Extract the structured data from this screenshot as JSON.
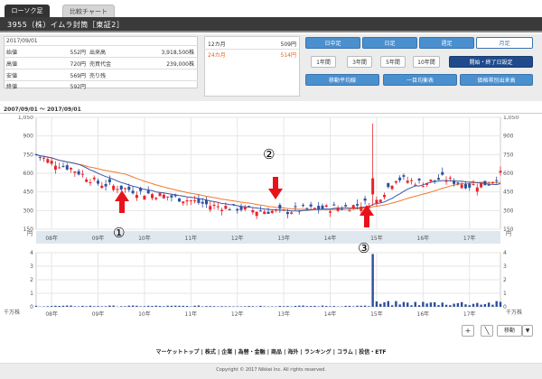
{
  "tabs": [
    {
      "label": "ローソク足",
      "active": true
    },
    {
      "label": "比較チャート",
      "active": false
    }
  ],
  "title": "3955（株）イムラ封筒［東証2］",
  "info": {
    "date": "2017/09/01",
    "rows": [
      {
        "l1": "始値",
        "v1": "552円",
        "l2": "出来高",
        "v2": "3,918,500株"
      },
      {
        "l1": "高値",
        "v1": "720円",
        "l2": "売買代金",
        "v2": "239,000株"
      },
      {
        "l1": "安値",
        "v1": "569円",
        "l2": "売り残",
        "v2": ""
      },
      {
        "l1": "終値",
        "v1": "592円",
        "l2": "",
        "v2": ""
      }
    ]
  },
  "price_panel": [
    {
      "label": "12カ月",
      "value": "509円",
      "color": "#333333"
    },
    {
      "label": "24カ月",
      "value": "514円",
      "color": "#e8621a"
    }
  ],
  "period_buttons": [
    "日中足",
    "日足",
    "週足",
    "月足"
  ],
  "selected_period": 3,
  "span_buttons": [
    "1年間",
    "3年間",
    "5年間",
    "10年間"
  ],
  "set_range_button": "開始・終了日設定",
  "indicator_buttons": [
    "移動平均線",
    "一目均衡表",
    "価格帯別出来高"
  ],
  "range_label": "2007/09/01 〜 2017/09/01",
  "price_axis": {
    "ticks": [
      "1,050",
      "900",
      "750",
      "600",
      "450",
      "300",
      "150"
    ],
    "unit": "円"
  },
  "volume_axis": {
    "ticks": [
      "4",
      "3",
      "2",
      "1",
      "0"
    ],
    "unit": "千万株"
  },
  "x_labels": [
    "08年",
    "09年",
    "10年",
    "11年",
    "12年",
    "13年",
    "14年",
    "15年",
    "16年",
    "17年"
  ],
  "annotations": [
    "①",
    "②",
    "③"
  ],
  "colors": {
    "up": "#e8242b",
    "down": "#2c4f9e",
    "ma_short": "#3b56a8",
    "ma_long": "#f07a2a",
    "arrow": "#e8121a"
  },
  "toolbar": {
    "zoom_label": "+",
    "pen_label": "╲",
    "move_label": "移動",
    "dropdown_label": "▼"
  },
  "footer_links": [
    "マーケットトップ",
    "株式",
    "企業",
    "為替・金融",
    "商品",
    "海外",
    "ランキング",
    "コラム",
    "投信・ETF"
  ],
  "copyright": "Copyright © 2017 Nikkei Inc. All rights reserved.",
  "chart_data": [
    {
      "type": "candlestick",
      "title": "",
      "xlabel": "",
      "ylabel": "円",
      "ylim": [
        150,
        1050
      ],
      "x_range": [
        "2007-09",
        "2017-09"
      ],
      "grid": true,
      "monthly_close_approx": [
        {
          "date": "2007-09",
          "value": 750
        },
        {
          "date": "2008-01",
          "value": 690
        },
        {
          "date": "2008-06",
          "value": 640
        },
        {
          "date": "2009-01",
          "value": 520
        },
        {
          "date": "2009-06",
          "value": 490
        },
        {
          "date": "2010-01",
          "value": 440
        },
        {
          "date": "2010-06",
          "value": 420
        },
        {
          "date": "2011-01",
          "value": 380
        },
        {
          "date": "2011-06",
          "value": 340
        },
        {
          "date": "2012-01",
          "value": 320
        },
        {
          "date": "2012-06",
          "value": 300
        },
        {
          "date": "2013-01",
          "value": 290
        },
        {
          "date": "2013-06",
          "value": 310
        },
        {
          "date": "2014-01",
          "value": 320
        },
        {
          "date": "2014-06",
          "value": 330
        },
        {
          "date": "2015-01",
          "value": 380
        },
        {
          "date": "2015-06",
          "value": 560
        },
        {
          "date": "2016-01",
          "value": 520
        },
        {
          "date": "2016-06",
          "value": 560
        },
        {
          "date": "2017-01",
          "value": 500
        },
        {
          "date": "2017-06",
          "value": 520
        },
        {
          "date": "2017-09",
          "value": 592
        }
      ],
      "peak": {
        "date": "2014-12",
        "high": 1000
      }
    },
    {
      "type": "bar",
      "title": "",
      "ylabel": "千万株",
      "ylim": [
        0,
        4
      ],
      "x_range": [
        "2007-09",
        "2017-09"
      ],
      "spike": {
        "date": "2014-12",
        "value": 3.9
      }
    }
  ]
}
